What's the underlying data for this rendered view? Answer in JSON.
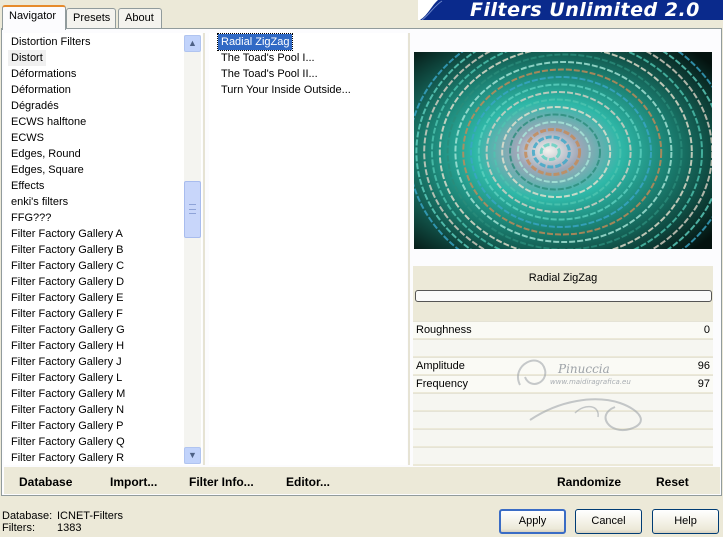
{
  "tabs": [
    {
      "label": "Navigator",
      "active": true
    },
    {
      "label": "Presets",
      "active": false
    },
    {
      "label": "About",
      "active": false
    }
  ],
  "banner": {
    "title": "Filters Unlimited 2.0",
    "color": "#0a2a8c"
  },
  "categories": {
    "selected": "Distort",
    "items": [
      "Distortion Filters",
      "Distort",
      "Déformations",
      "Déformation",
      "Dégradés",
      "ECWS halftone",
      "ECWS",
      "Edges, Round",
      "Edges, Square",
      "Effects",
      "enki's filters",
      "FFG???",
      "Filter Factory Gallery A",
      "Filter Factory Gallery B",
      "Filter Factory Gallery C",
      "Filter Factory Gallery D",
      "Filter Factory Gallery E",
      "Filter Factory Gallery F",
      "Filter Factory Gallery G",
      "Filter Factory Gallery H",
      "Filter Factory Gallery J",
      "Filter Factory Gallery L",
      "Filter Factory Gallery M",
      "Filter Factory Gallery N",
      "Filter Factory Gallery P",
      "Filter Factory Gallery Q",
      "Filter Factory Gallery R"
    ]
  },
  "filters": {
    "selected": "Radial ZigZag",
    "items": [
      "Radial ZigZag",
      "The Toad's Pool I...",
      "The Toad's Pool II...",
      "Turn Your Inside Outside..."
    ]
  },
  "preview": {
    "effect_name": "Radial ZigZag"
  },
  "sliders": [
    {
      "label": "Roughness",
      "value": "0"
    },
    {
      "label": "",
      "value": ""
    },
    {
      "label": "Amplitude",
      "value": "96"
    },
    {
      "label": "Frequency",
      "value": "97"
    },
    {
      "label": "",
      "value": ""
    },
    {
      "label": "",
      "value": ""
    },
    {
      "label": "",
      "value": ""
    },
    {
      "label": "",
      "value": ""
    }
  ],
  "watermark": {
    "text": "Pinuccia",
    "subtext": "www.maidiragrafica.eu"
  },
  "toolbar": {
    "database": "Database",
    "import": "Import...",
    "filter_info": "Filter Info...",
    "editor": "Editor...",
    "randomize": "Randomize",
    "reset": "Reset"
  },
  "footer": {
    "database_label": "Database:",
    "database_value": "ICNET-Filters",
    "filters_label": "Filters:",
    "filters_value": "1383"
  },
  "buttons": {
    "apply": "Apply",
    "cancel": "Cancel",
    "help": "Help"
  }
}
